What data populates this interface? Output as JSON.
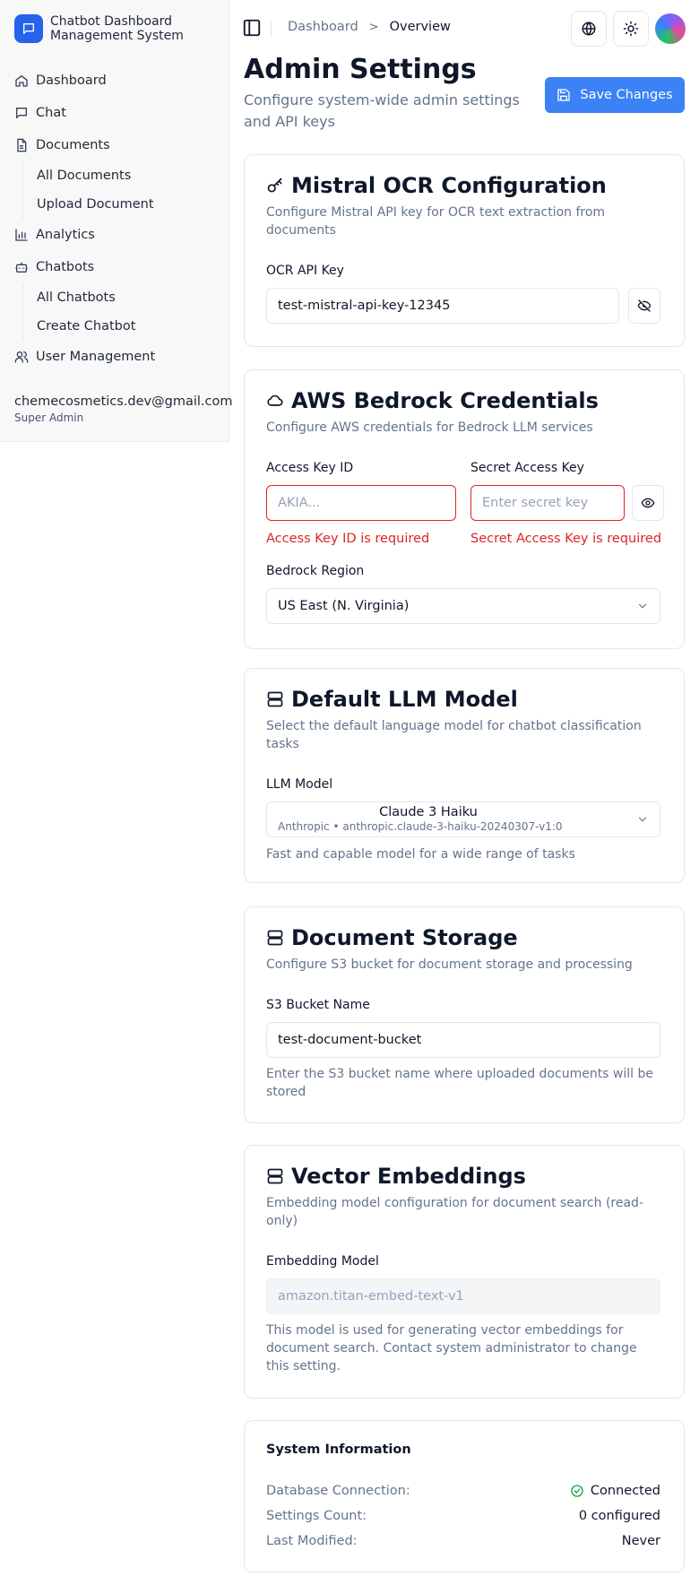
{
  "app": {
    "title": "Chatbot Dashboard Management System"
  },
  "sidebar": {
    "items": [
      {
        "label": "Dashboard",
        "icon": "home-icon"
      },
      {
        "label": "Chat",
        "icon": "message-icon"
      },
      {
        "label": "Documents",
        "icon": "document-icon",
        "children": [
          "All Documents",
          "Upload Document"
        ]
      },
      {
        "label": "Analytics",
        "icon": "bar-chart-icon"
      },
      {
        "label": "Chatbots",
        "icon": "bot-icon",
        "children": [
          "All Chatbots",
          "Create Chatbot"
        ]
      },
      {
        "label": "User Management",
        "icon": "users-icon"
      }
    ],
    "user": {
      "email": "chemecosmetics.dev@gmail.com",
      "role": "Super Admin"
    }
  },
  "topbar": {
    "breadcrumb": {
      "parent": "Dashboard",
      "separator": ">",
      "current": "Overview"
    }
  },
  "header": {
    "title": "Admin Settings",
    "subtitle": "Configure system-wide admin settings and API keys",
    "save_label": "Save Changes"
  },
  "ocr": {
    "title": "Mistral OCR Configuration",
    "description": "Configure Mistral API key for OCR text extraction from documents",
    "label": "OCR API Key",
    "value": "test-mistral-api-key-12345"
  },
  "aws": {
    "title": "AWS Bedrock Credentials",
    "description": "Configure AWS credentials for Bedrock LLM services",
    "access_label": "Access Key ID",
    "access_placeholder": "AKIA...",
    "access_error": "Access Key ID is required",
    "secret_label": "Secret Access Key",
    "secret_placeholder": "Enter secret key",
    "secret_error": "Secret Access Key is required",
    "region_label": "Bedrock Region",
    "region_value": "US East (N. Virginia)"
  },
  "llm": {
    "title": "Default LLM Model",
    "description": "Select the default language model for chatbot classification tasks",
    "label": "LLM Model",
    "model_name": "Claude 3 Haiku",
    "model_meta": "Anthropic • anthropic.claude-3-haiku-20240307-v1:0",
    "help": "Fast and capable model for a wide range of tasks"
  },
  "storage": {
    "title": "Document Storage",
    "description": "Configure S3 bucket for document storage and processing",
    "label": "S3 Bucket Name",
    "value": "test-document-bucket",
    "help": "Enter the S3 bucket name where uploaded documents will be stored"
  },
  "embeddings": {
    "title": "Vector Embeddings",
    "description": "Embedding model configuration for document search (read-only)",
    "label": "Embedding Model",
    "value": "amazon.titan-embed-text-v1",
    "help": "This model is used for generating vector embeddings for document search. Contact system administrator to change this setting."
  },
  "system": {
    "title": "System Information",
    "rows": [
      {
        "key": "Database Connection:",
        "value": "Connected"
      },
      {
        "key": "Settings Count:",
        "value": "0 configured"
      },
      {
        "key": "Last Modified:",
        "value": "Never"
      }
    ]
  },
  "colors": {
    "accent": "#3b82f6",
    "brand": "#2563eb",
    "error": "#dc2626",
    "success": "#16a34a"
  }
}
